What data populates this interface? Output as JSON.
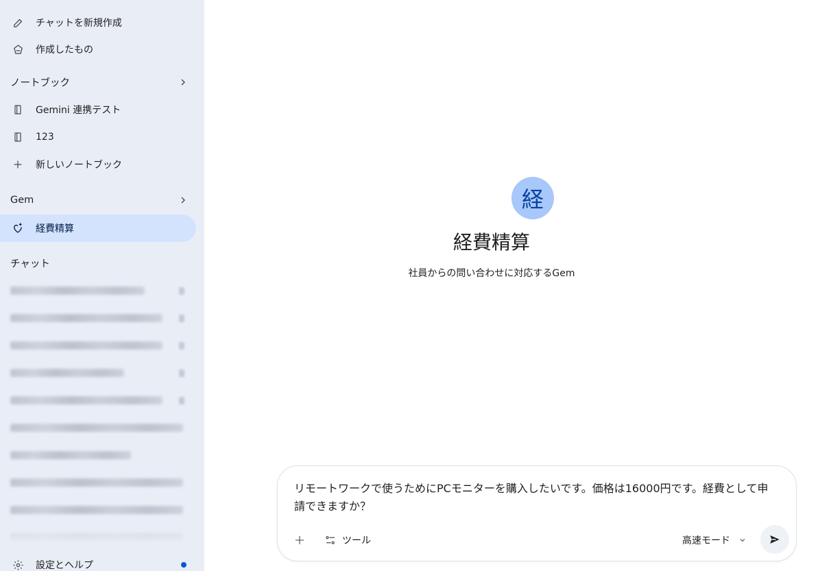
{
  "sidebar": {
    "new_chat": "チャットを新規作成",
    "my_stuff": "作成したもの",
    "notebook_section": "ノートブック",
    "notebooks": [
      {
        "label": "Gemini 連携テスト"
      },
      {
        "label": "123"
      }
    ],
    "new_notebook": "新しいノートブック",
    "gem_section": "Gem",
    "active_gem": "経費精算",
    "chat_section": "チャット",
    "settings": "設定とヘルプ"
  },
  "gem": {
    "avatar_char": "経",
    "title": "経費精算",
    "description": "社員からの問い合わせに対応するGem"
  },
  "composer": {
    "text": "リモートワークで使うためにPCモニターを購入したいです。価格は16000円です。経費として申請できますか？",
    "tools_label": "ツール",
    "mode_label": "高速モード"
  },
  "colors": {
    "sidebar_bg": "#e9eef6",
    "active_bg": "#d3e3fd",
    "avatar_bg": "#a8c7fa",
    "accent": "#0b57d0"
  }
}
